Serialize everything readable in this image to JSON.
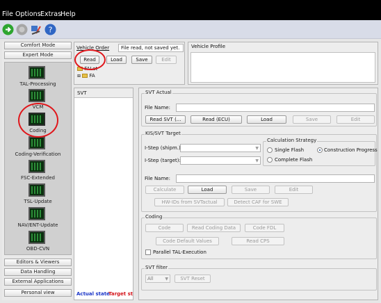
{
  "menu": [
    "File",
    "Options",
    "Extras",
    "Help"
  ],
  "toolbar": {
    "icons": [
      "green-arrow-icon",
      "gray-circle-icon",
      "vehicle-tools-icon",
      "help-icon"
    ]
  },
  "sidebar": {
    "top_buttons": [
      "Comfort Mode",
      "Expert Mode"
    ],
    "modes": [
      "TAL-Processing",
      "VCM",
      "Coding",
      "Coding-Verification",
      "FSC-Extended",
      "TSL-Update",
      "NAV/ENT-Update",
      "OBD-CVN"
    ],
    "bottom_buttons": [
      "Editors & Viewers",
      "Data Handling",
      "External Applications",
      "Personal view"
    ]
  },
  "vehicle_order": {
    "title": "Vehicle Order",
    "status": "File read, not saved yet.",
    "buttons": [
      "Read",
      "Load",
      "Save",
      "Edit"
    ],
    "tree": [
      "FALet",
      "FA"
    ]
  },
  "vehicle_profile": {
    "title": "Vehicle Profile"
  },
  "svt_panel": {
    "title": "SVT",
    "actual_state": "Actual state",
    "target_state": "Target st"
  },
  "svt_actual": {
    "title": "SVT Actual",
    "file_name_label": "File Name:",
    "file_name_value": "",
    "buttons": [
      "Read SVT (...",
      "Read (ECU)",
      "Load",
      "Save",
      "Edit"
    ]
  },
  "kis_svt_target": {
    "title": "KIS/SVT Target",
    "i_step_shipm_label": "I-Step (shipm.):",
    "i_step_target_label": "I-Step (target):",
    "calculation_strategy": {
      "title": "Calculation Strategy",
      "options": [
        "Single Flash",
        "Construction Progress",
        "Complete Flash"
      ],
      "selected": "Construction Progress"
    },
    "file_name_label": "File Name:",
    "file_name_value": "",
    "buttons": [
      "Calculate",
      "Load",
      "Save",
      "Edit"
    ],
    "buttons2": [
      "HW-IDs from SVTactual",
      "Detect CAF for SWE"
    ]
  },
  "coding": {
    "title": "Coding",
    "buttons": [
      "Code",
      "Read Coding Data",
      "Code FDL"
    ],
    "buttons2": [
      "Code Default Values",
      "Read CPS"
    ],
    "parallel_label": "Parallel TAL-Execution",
    "parallel_checked": false
  },
  "svt_filter": {
    "title": "SVT filter",
    "filter_value": "All",
    "reset_label": "SVT Reset"
  },
  "colors": {
    "highlight": "#e0161b",
    "actual_state": "#1a35c8",
    "target_state": "#d4151b",
    "mode_bg": "#d0d0d0"
  }
}
